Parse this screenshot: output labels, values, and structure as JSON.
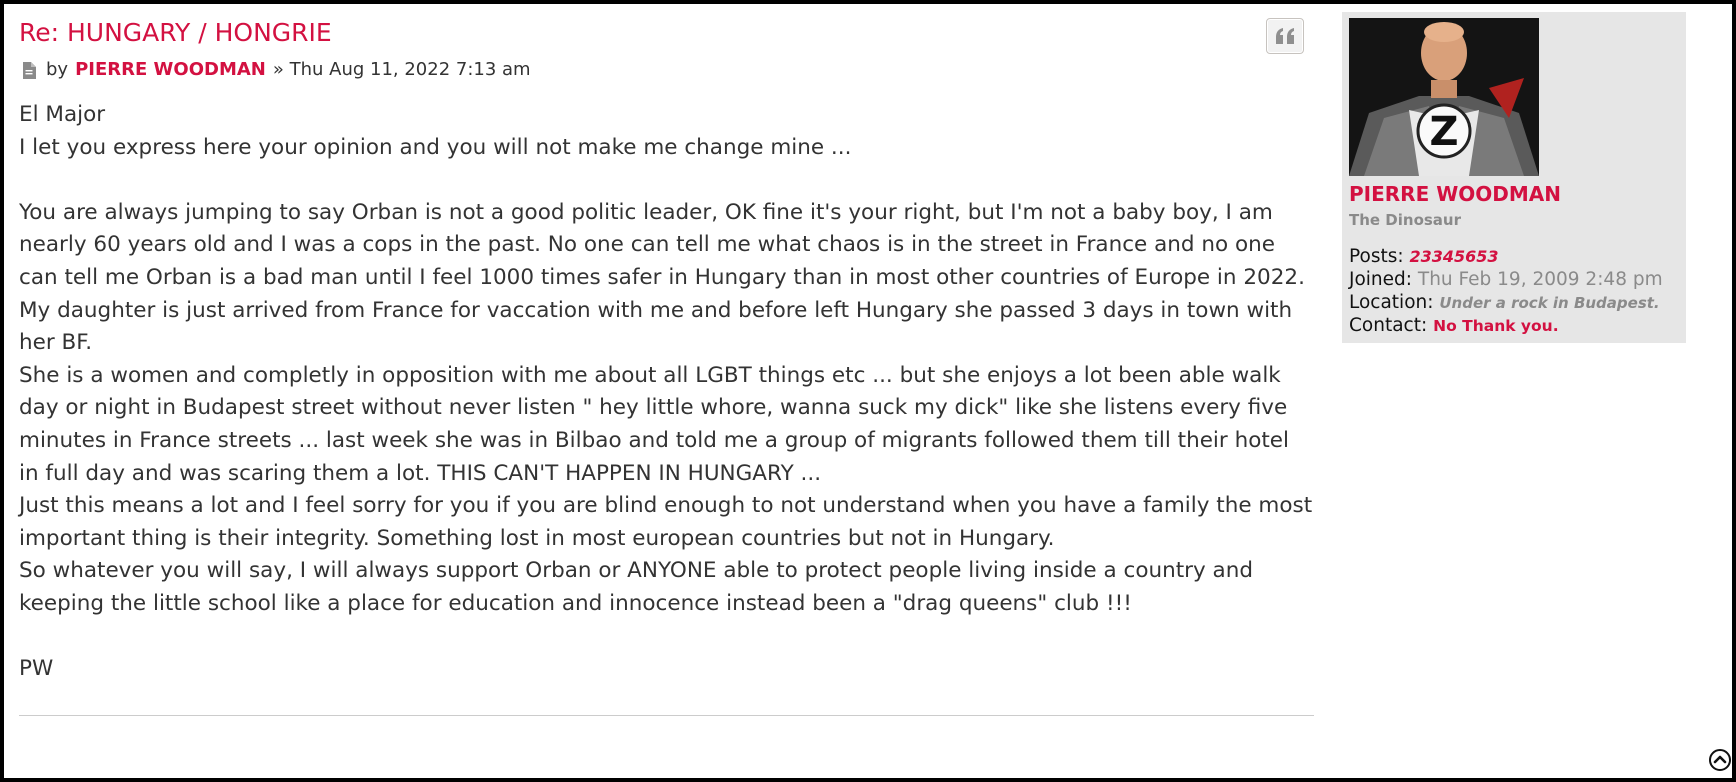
{
  "post": {
    "title": "Re: HUNGARY / HONGRIE",
    "by_label": "by",
    "author": "PIERRE WOODMAN",
    "date": "» Thu Aug 11, 2022 7:13 am",
    "paragraphs": [
      "El Major",
      "I let you express here your opinion and you will not make me change mine ...",
      "",
      "You are always jumping to say Orban is not a good politic leader, OK fine it's your right, but I'm not a baby boy, I am nearly 60 years old and I was a cops in the past. No one can tell me what chaos is in the street in France and no one can tell me Orban is a bad man until I feel 1000 times safer in Hungary than in most other countries of Europe in 2022.",
      "My daughter is just arrived from France for vaccation with me and before left Hungary she passed 3 days in town with her BF.",
      "She is a women and completly in opposition with me about all LGBT things etc ... but she enjoys a lot been able walk day or night in Budapest street without never listen \" hey little whore, wanna suck my dick\" like she listens every five minutes in France streets ... last week she was in Bilbao and told me a group of migrants followed them till their hotel in full day and was scaring them a lot. THIS CAN'T HAPPEN IN HUNGARY ...",
      "Just this means a lot and I feel sorry for you if you are blind enough to not understand when you have a family the most important thing is their integrity. Something lost in most european countries but not in Hungary.",
      "So whatever you will say, I will always support Orban or ANYONE able to protect people living inside a country and keeping the little school like a place for education and innocence instead been a \"drag queens\" club !!!",
      "",
      "PW"
    ]
  },
  "profile": {
    "name": "PIERRE WOODMAN",
    "rank": "The Dinosaur",
    "posts_label": "Posts:",
    "posts_value": "23345653",
    "joined_label": "Joined:",
    "joined_value": "Thu Feb 19, 2009 2:48 pm",
    "location_label": "Location:",
    "location_value": "Under a rock in Budapest.",
    "contact_label": "Contact:",
    "contact_value": "No Thank you.",
    "avatar_letter": "Z"
  },
  "icons": {
    "quote": "quote-icon",
    "post": "document-icon",
    "top": "chevron-up-circle-icon"
  },
  "colors": {
    "accent": "#d31141",
    "text": "#333333",
    "profile_bg": "#e6e6e6"
  }
}
